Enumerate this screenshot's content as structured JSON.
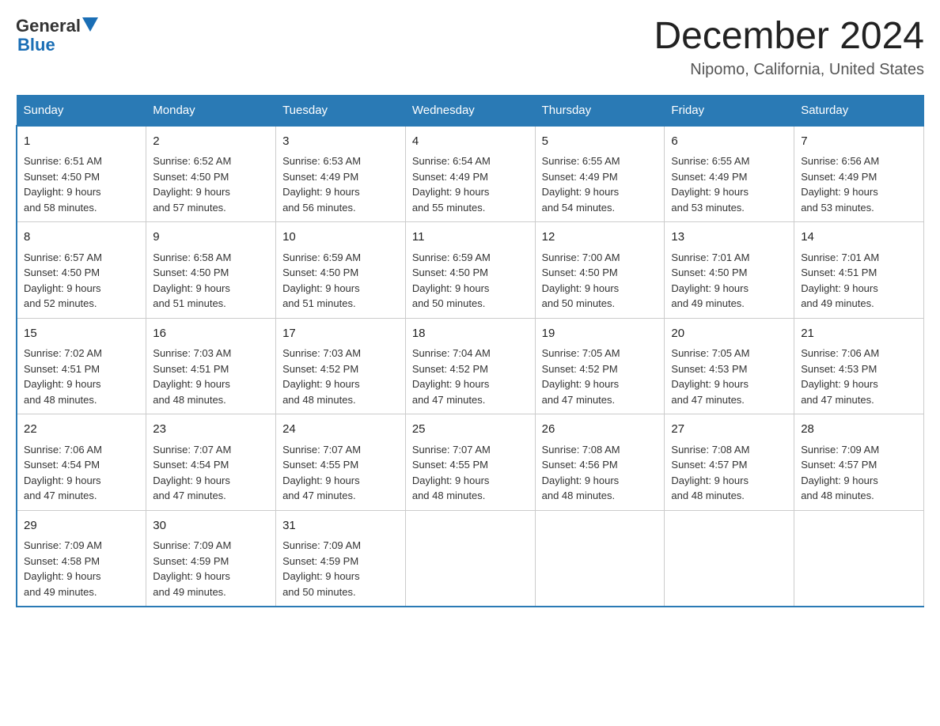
{
  "header": {
    "logo_general": "General",
    "logo_blue": "Blue",
    "month_title": "December 2024",
    "location": "Nipomo, California, United States"
  },
  "weekdays": [
    "Sunday",
    "Monday",
    "Tuesday",
    "Wednesday",
    "Thursday",
    "Friday",
    "Saturday"
  ],
  "weeks": [
    [
      {
        "day": "1",
        "sunrise": "6:51 AM",
        "sunset": "4:50 PM",
        "daylight": "9 hours and 58 minutes."
      },
      {
        "day": "2",
        "sunrise": "6:52 AM",
        "sunset": "4:50 PM",
        "daylight": "9 hours and 57 minutes."
      },
      {
        "day": "3",
        "sunrise": "6:53 AM",
        "sunset": "4:49 PM",
        "daylight": "9 hours and 56 minutes."
      },
      {
        "day": "4",
        "sunrise": "6:54 AM",
        "sunset": "4:49 PM",
        "daylight": "9 hours and 55 minutes."
      },
      {
        "day": "5",
        "sunrise": "6:55 AM",
        "sunset": "4:49 PM",
        "daylight": "9 hours and 54 minutes."
      },
      {
        "day": "6",
        "sunrise": "6:55 AM",
        "sunset": "4:49 PM",
        "daylight": "9 hours and 53 minutes."
      },
      {
        "day": "7",
        "sunrise": "6:56 AM",
        "sunset": "4:49 PM",
        "daylight": "9 hours and 53 minutes."
      }
    ],
    [
      {
        "day": "8",
        "sunrise": "6:57 AM",
        "sunset": "4:50 PM",
        "daylight": "9 hours and 52 minutes."
      },
      {
        "day": "9",
        "sunrise": "6:58 AM",
        "sunset": "4:50 PM",
        "daylight": "9 hours and 51 minutes."
      },
      {
        "day": "10",
        "sunrise": "6:59 AM",
        "sunset": "4:50 PM",
        "daylight": "9 hours and 51 minutes."
      },
      {
        "day": "11",
        "sunrise": "6:59 AM",
        "sunset": "4:50 PM",
        "daylight": "9 hours and 50 minutes."
      },
      {
        "day": "12",
        "sunrise": "7:00 AM",
        "sunset": "4:50 PM",
        "daylight": "9 hours and 50 minutes."
      },
      {
        "day": "13",
        "sunrise": "7:01 AM",
        "sunset": "4:50 PM",
        "daylight": "9 hours and 49 minutes."
      },
      {
        "day": "14",
        "sunrise": "7:01 AM",
        "sunset": "4:51 PM",
        "daylight": "9 hours and 49 minutes."
      }
    ],
    [
      {
        "day": "15",
        "sunrise": "7:02 AM",
        "sunset": "4:51 PM",
        "daylight": "9 hours and 48 minutes."
      },
      {
        "day": "16",
        "sunrise": "7:03 AM",
        "sunset": "4:51 PM",
        "daylight": "9 hours and 48 minutes."
      },
      {
        "day": "17",
        "sunrise": "7:03 AM",
        "sunset": "4:52 PM",
        "daylight": "9 hours and 48 minutes."
      },
      {
        "day": "18",
        "sunrise": "7:04 AM",
        "sunset": "4:52 PM",
        "daylight": "9 hours and 47 minutes."
      },
      {
        "day": "19",
        "sunrise": "7:05 AM",
        "sunset": "4:52 PM",
        "daylight": "9 hours and 47 minutes."
      },
      {
        "day": "20",
        "sunrise": "7:05 AM",
        "sunset": "4:53 PM",
        "daylight": "9 hours and 47 minutes."
      },
      {
        "day": "21",
        "sunrise": "7:06 AM",
        "sunset": "4:53 PM",
        "daylight": "9 hours and 47 minutes."
      }
    ],
    [
      {
        "day": "22",
        "sunrise": "7:06 AM",
        "sunset": "4:54 PM",
        "daylight": "9 hours and 47 minutes."
      },
      {
        "day": "23",
        "sunrise": "7:07 AM",
        "sunset": "4:54 PM",
        "daylight": "9 hours and 47 minutes."
      },
      {
        "day": "24",
        "sunrise": "7:07 AM",
        "sunset": "4:55 PM",
        "daylight": "9 hours and 47 minutes."
      },
      {
        "day": "25",
        "sunrise": "7:07 AM",
        "sunset": "4:55 PM",
        "daylight": "9 hours and 48 minutes."
      },
      {
        "day": "26",
        "sunrise": "7:08 AM",
        "sunset": "4:56 PM",
        "daylight": "9 hours and 48 minutes."
      },
      {
        "day": "27",
        "sunrise": "7:08 AM",
        "sunset": "4:57 PM",
        "daylight": "9 hours and 48 minutes."
      },
      {
        "day": "28",
        "sunrise": "7:09 AM",
        "sunset": "4:57 PM",
        "daylight": "9 hours and 48 minutes."
      }
    ],
    [
      {
        "day": "29",
        "sunrise": "7:09 AM",
        "sunset": "4:58 PM",
        "daylight": "9 hours and 49 minutes."
      },
      {
        "day": "30",
        "sunrise": "7:09 AM",
        "sunset": "4:59 PM",
        "daylight": "9 hours and 49 minutes."
      },
      {
        "day": "31",
        "sunrise": "7:09 AM",
        "sunset": "4:59 PM",
        "daylight": "9 hours and 50 minutes."
      },
      null,
      null,
      null,
      null
    ]
  ],
  "labels": {
    "sunrise": "Sunrise:",
    "sunset": "Sunset:",
    "daylight": "Daylight:"
  }
}
